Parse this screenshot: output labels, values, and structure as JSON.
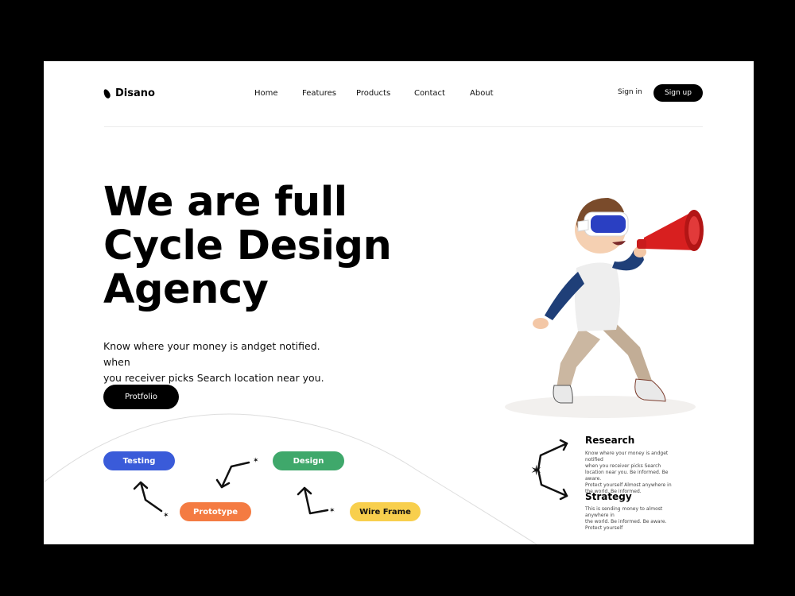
{
  "brand": {
    "name": "Disano"
  },
  "nav": [
    "Home",
    "Features",
    "Products",
    "Contact",
    "About"
  ],
  "auth": {
    "signin": "Sign in",
    "signup": "Sign up"
  },
  "hero": {
    "headline_lines": [
      "We are full",
      "Cycle Design",
      "Agency"
    ],
    "subtext_lines": [
      "Know where your money is andget notified. when",
      "you receiver picks Search location near you."
    ],
    "button": "Protfolio"
  },
  "process": [
    {
      "label": "Testing",
      "color": "#3a5bd9"
    },
    {
      "label": "Prototype",
      "color": "#f47b42"
    },
    {
      "label": "Design",
      "color": "#3fa86b"
    },
    {
      "label": "Wire Frame",
      "color": "#f8cf4d"
    }
  ],
  "info": [
    {
      "title": "Research",
      "text_lines": [
        "Know where your money is andget notified",
        "when you receiver picks Search",
        "location near you. Be informed. Be aware.",
        "Protect yourself Almost anywhere in",
        "the world. Be informed."
      ]
    },
    {
      "title": "Strategy",
      "text_lines": [
        "This is sending money to almost anywhere in",
        "the world. Be informed. Be aware.",
        "Protect yourself"
      ]
    }
  ],
  "colors": {
    "megaphone": "#d81f1f",
    "shirt_sleeve": "#1f3f78",
    "pants": "#cbb7a1",
    "visor": "#2a3fc2"
  }
}
